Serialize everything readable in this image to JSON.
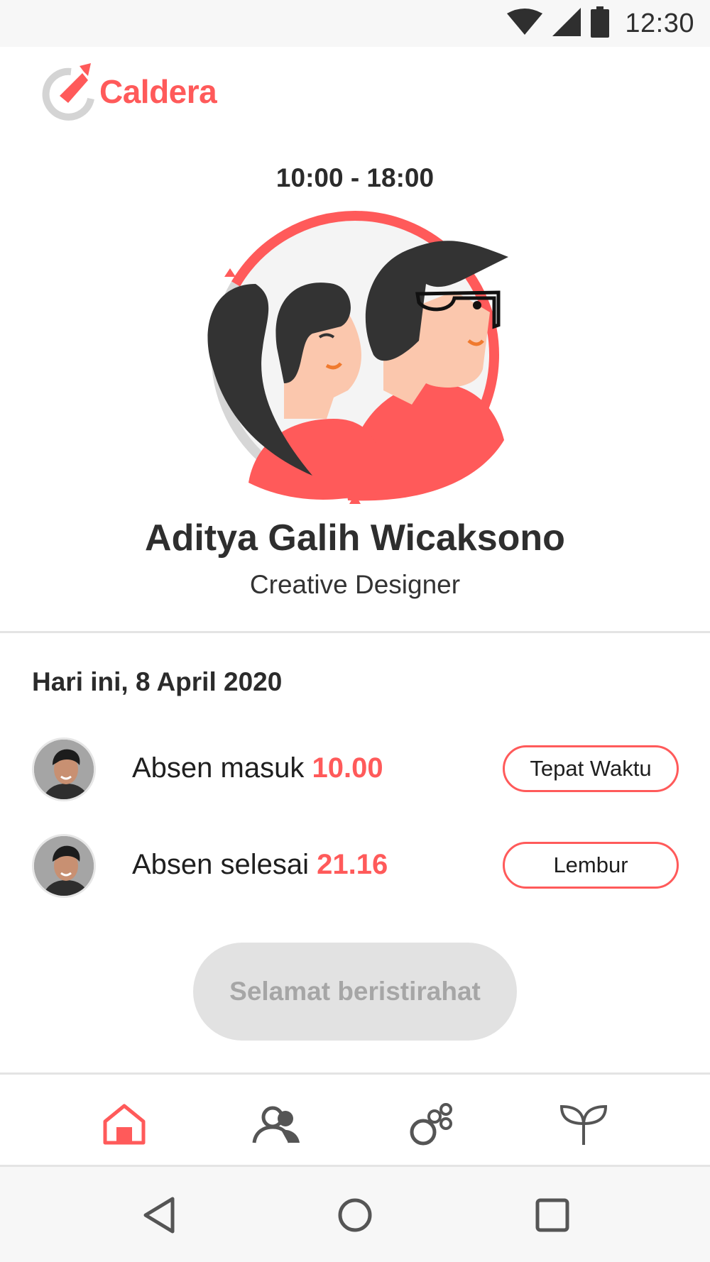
{
  "status_bar": {
    "time": "12:30",
    "icons": [
      "wifi-icon",
      "signal-icon",
      "battery-icon"
    ]
  },
  "app": {
    "logo_text": "Caldera",
    "brand_color": "#ff5a5a"
  },
  "profile": {
    "shift": "10:00 - 18:00",
    "name": "Aditya Galih Wicaksono",
    "role": "Creative Designer"
  },
  "attendance": {
    "date_heading": "Hari ini, 8 April 2020",
    "rows": [
      {
        "label": "Absen masuk",
        "time": "10.00",
        "badge": "Tepat Waktu"
      },
      {
        "label": "Absen selesai",
        "time": "21.16",
        "badge": "Lembur"
      }
    ]
  },
  "action": {
    "rest_label": "Selamat beristirahat"
  },
  "bottom_nav": {
    "items": [
      "home-icon",
      "people-icon",
      "apps-icon",
      "sprout-icon"
    ],
    "active": "home-icon"
  },
  "system_nav": [
    "back-icon",
    "home-circle-icon",
    "recents-icon"
  ]
}
